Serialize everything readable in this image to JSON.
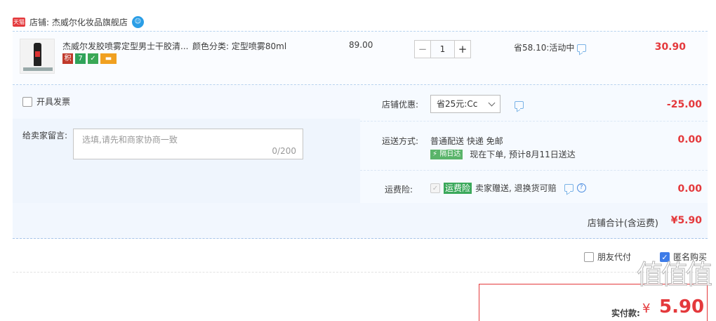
{
  "shop": {
    "logo_text": "天猫",
    "name": "店铺: 杰威尔化妆品旗舰店",
    "ww_icon": "wangwang-chat-icon"
  },
  "item": {
    "title": "杰威尔发胶喷雾定型男士干胶清...",
    "sku": "颜色分类: 定型喷雾80ml",
    "badges": [
      "积",
      "7",
      "",
      ""
    ],
    "unit_price": "89.00",
    "quantity": "1",
    "minus": "−",
    "plus": "+",
    "promo": "省58.10:活动中",
    "subtotal": "30.90"
  },
  "invoice": {
    "label": "开具发票"
  },
  "message": {
    "label": "给卖家留言:",
    "placeholder": "选填,请先和商家协商一致",
    "counter": "0/200"
  },
  "coupon": {
    "label": "店铺优惠:",
    "selected": "省25元:Cc",
    "amount": "-25.00"
  },
  "shipping": {
    "label": "运送方式:",
    "method": "普通配送 快递 免邮",
    "tag": "隔日达",
    "eta": "现在下单, 预计8月11日送达",
    "amount": "0.00"
  },
  "insurance": {
    "label": "运费险:",
    "tag": "运费险",
    "desc": "卖家赠送, 退换货可赔",
    "amount": "0.00"
  },
  "shop_total": {
    "label": "店铺合计(含运费)",
    "amount": "¥5.90"
  },
  "options": {
    "friend_pay": "朋友代付",
    "anonymous": "匿名购买",
    "anonymous_checked": true
  },
  "payable": {
    "label": "实付款:",
    "currency": "¥",
    "amount": "5.90"
  },
  "watermark": {
    "text": "值值值"
  },
  "colors": {
    "accent": "#e4393c",
    "link": "#3e7ce8"
  }
}
